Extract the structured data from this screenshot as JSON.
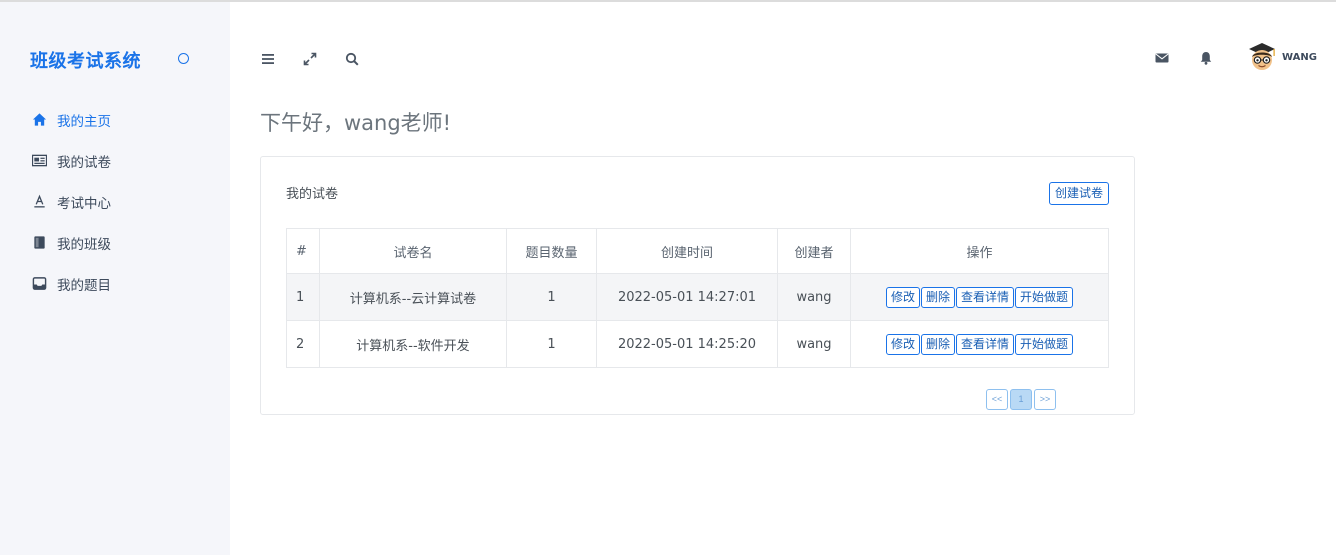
{
  "app": {
    "title": "班级考试系统"
  },
  "sidebar": {
    "items": [
      {
        "label": "我的主页",
        "icon": "home-icon",
        "active": true
      },
      {
        "label": "我的试卷",
        "icon": "newspaper-icon",
        "active": false
      },
      {
        "label": "考试中心",
        "icon": "font-a-icon",
        "active": false
      },
      {
        "label": "我的班级",
        "icon": "book-icon",
        "active": false
      },
      {
        "label": "我的题目",
        "icon": "inbox-icon",
        "active": false
      }
    ]
  },
  "header": {
    "icons": [
      "menu-icon",
      "expand-icon",
      "search-icon",
      "mail-icon",
      "bell-icon"
    ],
    "user": {
      "name": "WANG"
    }
  },
  "greeting": "下午好，wang老师!",
  "card": {
    "title": "我的试卷",
    "create_label": "创建试卷",
    "columns": [
      "#",
      "试卷名",
      "题目数量",
      "创建时间",
      "创建者",
      "操作"
    ],
    "rows": [
      {
        "id": "1",
        "name": "计算机系--云计算试卷",
        "count": "1",
        "created": "2022-05-01 14:27:01",
        "creator": "wang"
      },
      {
        "id": "2",
        "name": "计算机系--软件开发",
        "count": "1",
        "created": "2022-05-01 14:25:20",
        "creator": "wang"
      }
    ],
    "actions": [
      "修改",
      "删除",
      "查看详情",
      "开始做题"
    ]
  },
  "pager": {
    "prev": "<<",
    "current": "1",
    "next": ">>"
  },
  "colors": {
    "accent": "#1a73e8",
    "sidebar_bg": "#f5f6fa"
  }
}
